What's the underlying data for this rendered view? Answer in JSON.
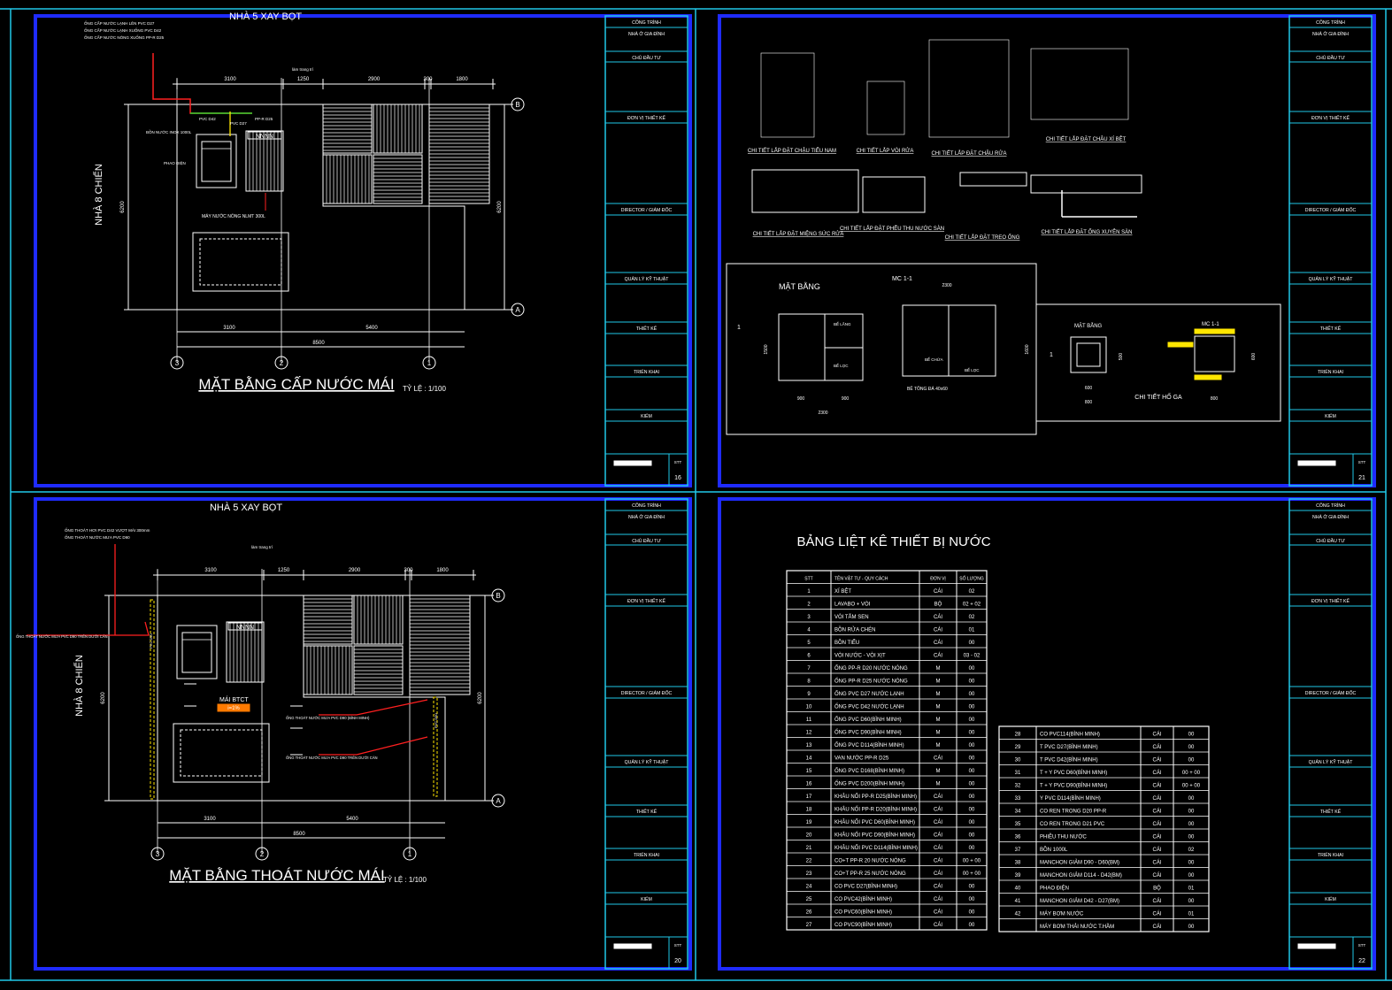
{
  "sheets": [
    {
      "id": "s16",
      "number": "16",
      "building_label": "NHÀ 5 XAY BỌT",
      "side_label": "NHÀ 8 CHIẾN",
      "title": "MẶT BẰNG CẤP NƯỚC MÁI",
      "scale": "TỶ LỆ : 1/100",
      "notes": [
        "ỐNG CẤP NƯỚC LẠNH LÊN PVC D27",
        "ỐNG CẤP NƯỚC LẠNH XUỐNG PVC D42",
        "ỐNG CẤP NƯỚC NÓNG XUỐNG PP-R D25"
      ],
      "callouts": [
        "BỒN NƯỚC INOX 1000L",
        "PHAO ĐIỆN",
        "MÁY NƯỚC NÓNG NLMT 300L",
        "PVC D27",
        "PP-R D25",
        "PVC D42",
        "làm trang trí"
      ],
      "dims_top": [
        "3100",
        "1250",
        "2900",
        "300",
        "1800"
      ],
      "dims_bottom": [
        "3100",
        "5400"
      ],
      "dim_total": "8500",
      "dim_side": "6200",
      "axes": [
        "3",
        "2",
        "1"
      ],
      "grid_rows": [
        "B",
        "A"
      ],
      "sign": "NNNN"
    },
    {
      "id": "s20",
      "number": "20",
      "building_label": "NHÀ 5 XAY BỌT",
      "side_label": "NHÀ 8 CHIẾN",
      "title": "MẶT BẰNG THOÁT NƯỚC MÁI",
      "scale": "TỶ LỆ : 1/100",
      "notes": [
        "ỐNG THOÁT HƠI PVC D42 VƯỢT MÁI 300mm",
        "ỐNG THOÁT NƯỚC MƯA PVC D90"
      ],
      "callouts": [
        "ỐNG THOÁT NƯỚC MƯA PVC D90 TRÊN DƯỚI CÁN",
        "ỐNG THOÁT NƯỚC MƯA PVC D90 (BÌNH MINH)",
        "ỐNG THOÁT NƯỚC MƯA PVC D90 TRÊN DƯỚI CÁN",
        "MÁI BTCT",
        "i=1%",
        "làm trang trí",
        "PVC D90"
      ],
      "dims_top": [
        "3100",
        "1250",
        "2900",
        "300",
        "1800"
      ],
      "dims_bottom": [
        "3100",
        "5400"
      ],
      "dim_total": "8500",
      "dim_side": "6200",
      "axes": [
        "3",
        "2",
        "1"
      ],
      "grid_rows": [
        "B",
        "A"
      ],
      "sign": "NNNN"
    }
  ],
  "detail_sheet": {
    "number": "21",
    "detail_titles": [
      "CHI TIẾT LẮP ĐẶT CHẬU TIỂU NAM",
      "CHI TIẾT LẮP VÒI RỬA",
      "CHI TIẾT LẮP ĐẶT CHẬU RỬA",
      "CHI TIẾT LẮP ĐẶT CHẬU XÍ BỆT",
      "CHI TIẾT LẮP ĐẶT MIỆNG SỨC RỬA",
      "CHI TIẾT LẮP ĐẶT PHỄU THU NƯỚC SÀN",
      "CHI TIẾT LẮP ĐẶT TREO ỐNG",
      "CHI TIẾT LẮP ĐẶT ỐNG XUYÊN SÀN"
    ],
    "tank_plan_label": "MẶT BẰNG",
    "tank_section_label": "MC 1-1",
    "tank_labels": [
      "BỂ TỰ HOẠI",
      "BỂ CHỨA",
      "BỂ LỌC",
      "BỂ LẮNG",
      "BỂ LỌC",
      "BÊ TÔNG ĐÁ 40x60"
    ],
    "tank_dims": [
      "2300",
      "900",
      "900",
      "500",
      "2300",
      "1500",
      "1600"
    ],
    "pit_plan_label": "MẶT BẰNG",
    "pit_section_label": "MC 1-1",
    "pit_title": "CHI TIẾT HỐ GA",
    "pit_dims": [
      "600",
      "800",
      "800",
      "600",
      "500"
    ],
    "marks": [
      "1",
      "1"
    ]
  },
  "table_sheet": {
    "number": "22",
    "title": "BẢNG LIỆT KÊ THIẾT BỊ NƯỚC",
    "headers": [
      "STT",
      "TÊN VẬT TƯ - QUY CÁCH",
      "ĐƠN VỊ",
      "SỐ LƯỢNG"
    ],
    "rows_left": [
      [
        "1",
        "XÍ BỆT",
        "CÁI",
        "02"
      ],
      [
        "2",
        "LAVABO + VÒI",
        "BỘ",
        "02 + 02"
      ],
      [
        "3",
        "VÒI TẮM SEN",
        "CÁI",
        "02"
      ],
      [
        "4",
        "BỒN RỬA CHÉN",
        "CÁI",
        "01"
      ],
      [
        "5",
        "BỒN TIỂU",
        "CÁI",
        "00"
      ],
      [
        "6",
        "VÒI NƯỚC - VÒI XỊT",
        "CÁI",
        "03 - 02"
      ],
      [
        "7",
        "ỐNG PP-R D20 NƯỚC NÓNG",
        "M",
        "00"
      ],
      [
        "8",
        "ỐNG PP-R D25 NƯỚC NÓNG",
        "M",
        "00"
      ],
      [
        "9",
        "ỐNG PVC D27 NƯỚC LẠNH",
        "M",
        "00"
      ],
      [
        "10",
        "ỐNG PVC D42 NƯỚC LẠNH",
        "M",
        "00"
      ],
      [
        "11",
        "ỐNG PVC D60(BÌNH MINH)",
        "M",
        "00"
      ],
      [
        "12",
        "ỐNG PVC D90(BÌNH MINH)",
        "M",
        "00"
      ],
      [
        "13",
        "ỐNG PVC D114(BÌNH MINH)",
        "M",
        "00"
      ],
      [
        "14",
        "VAN NƯỚC PP-R D25",
        "CÁI",
        "00"
      ],
      [
        "15",
        "ỐNG PVC D168(BÌNH MINH)",
        "M",
        "00"
      ],
      [
        "16",
        "ỐNG PVC D200(BÌNH MINH)",
        "M",
        "00"
      ],
      [
        "17",
        "KHÂU NỐI PP-R D25(BÌNH MINH)",
        "CÁI",
        "00"
      ],
      [
        "18",
        "KHÂU NỐI PP-R D20(BÌNH MINH)",
        "CÁI",
        "00"
      ],
      [
        "19",
        "KHÂU NỐI PVC D60(BÌNH MINH)",
        "CÁI",
        "00"
      ],
      [
        "20",
        "KHÂU NỐI PVC D90(BÌNH MINH)",
        "CÁI",
        "00"
      ],
      [
        "21",
        "KHÂU NỐI PVC D114(BÌNH MINH)",
        "CÁI",
        "00"
      ],
      [
        "22",
        "CO+T PP-R 20 NƯỚC NÓNG",
        "CÁI",
        "00 + 00"
      ],
      [
        "23",
        "CO+T PP-R 25 NƯỚC NÓNG",
        "CÁI",
        "00 + 00"
      ],
      [
        "24",
        "CO PVC D27(BÌNH MINH)",
        "CÁI",
        "00"
      ],
      [
        "25",
        "CO PVC42(BÌNH MINH)",
        "CÁI",
        "00"
      ],
      [
        "26",
        "CO PVC60(BÌNH MINH)",
        "CÁI",
        "00"
      ],
      [
        "27",
        "CO PVC90(BÌNH MINH)",
        "CÁI",
        "00"
      ]
    ],
    "rows_right": [
      [
        "28",
        "CO PVC114(BÌNH MINH)",
        "CÁI",
        "00"
      ],
      [
        "29",
        "T PVC D27(BÌNH MINH)",
        "CÁI",
        "00"
      ],
      [
        "30",
        "T PVC D42(BÌNH MINH)",
        "CÁI",
        "00"
      ],
      [
        "31",
        "T + Y PVC D60(BÌNH MINH)",
        "CÁI",
        "00 + 00"
      ],
      [
        "32",
        "T + Y PVC D90(BÌNH MINH)",
        "CÁI",
        "00 + 00"
      ],
      [
        "33",
        "Y PVC D114(BÌNH MINH)",
        "CÁI",
        "00"
      ],
      [
        "34",
        "CO REN TRONG D20 PP-R",
        "CÁI",
        "00"
      ],
      [
        "35",
        "CO REN TRONG D21 PVC",
        "CÁI",
        "00"
      ],
      [
        "36",
        "PHIỄU THU NƯỚC",
        "CÁI",
        "00"
      ],
      [
        "37",
        "BỒN 1000L",
        "CÁI",
        "02"
      ],
      [
        "38",
        "MANCHON GIẢM D90 - D60(BM)",
        "CÁI",
        "00"
      ],
      [
        "39",
        "MANCHON GIẢM D114 - D42(BM)",
        "CÁI",
        "00"
      ],
      [
        "40",
        "PHAO ĐIỆN",
        "BỘ",
        "01"
      ],
      [
        "41",
        "MANCHON GIẢM D42 - D27(BM)",
        "CÁI",
        "00"
      ],
      [
        "42",
        "MÁY BƠM NƯỚC",
        "CÁI",
        "01"
      ],
      [
        "",
        "MÁY BƠM THẢI NƯỚC T.HẦM",
        "CÁI",
        "00"
      ]
    ]
  },
  "title_blocks": {
    "left": [
      "CÔNG TRÌNH",
      "NHÀ Ở GIA ĐÌNH",
      "CHỦ ĐẦU TƯ",
      "ĐƠN VỊ THIẾT KẾ",
      "DIRECTOR / GIÁM ĐỐC",
      "QUẢN LÝ KỸ THUẬT",
      "THIẾT KẾ",
      "TRIỂN KHAI",
      "KIỂM"
    ],
    "right": [
      "CÔNG TRÌNH",
      "NHÀ Ở GIA ĐÌNH",
      "CHỦ ĐẦU TƯ",
      "ĐƠN VỊ THIẾT KẾ",
      "DIRECTOR / GIÁM ĐỐC",
      "QUẢN LÝ KỸ THUẬT",
      "THIẾT KẾ",
      "TRIỂN KHAI",
      "KIỂM"
    ],
    "stt": "STT"
  },
  "colors": {
    "background": "#000000",
    "frame_cyan": "#20c8e8",
    "frame_blue": "#1f2bff",
    "line": "#ffffff",
    "red": "#ff2020",
    "yellow": "#ffe600",
    "green": "#2fd22f",
    "orange": "#ff7a00"
  }
}
